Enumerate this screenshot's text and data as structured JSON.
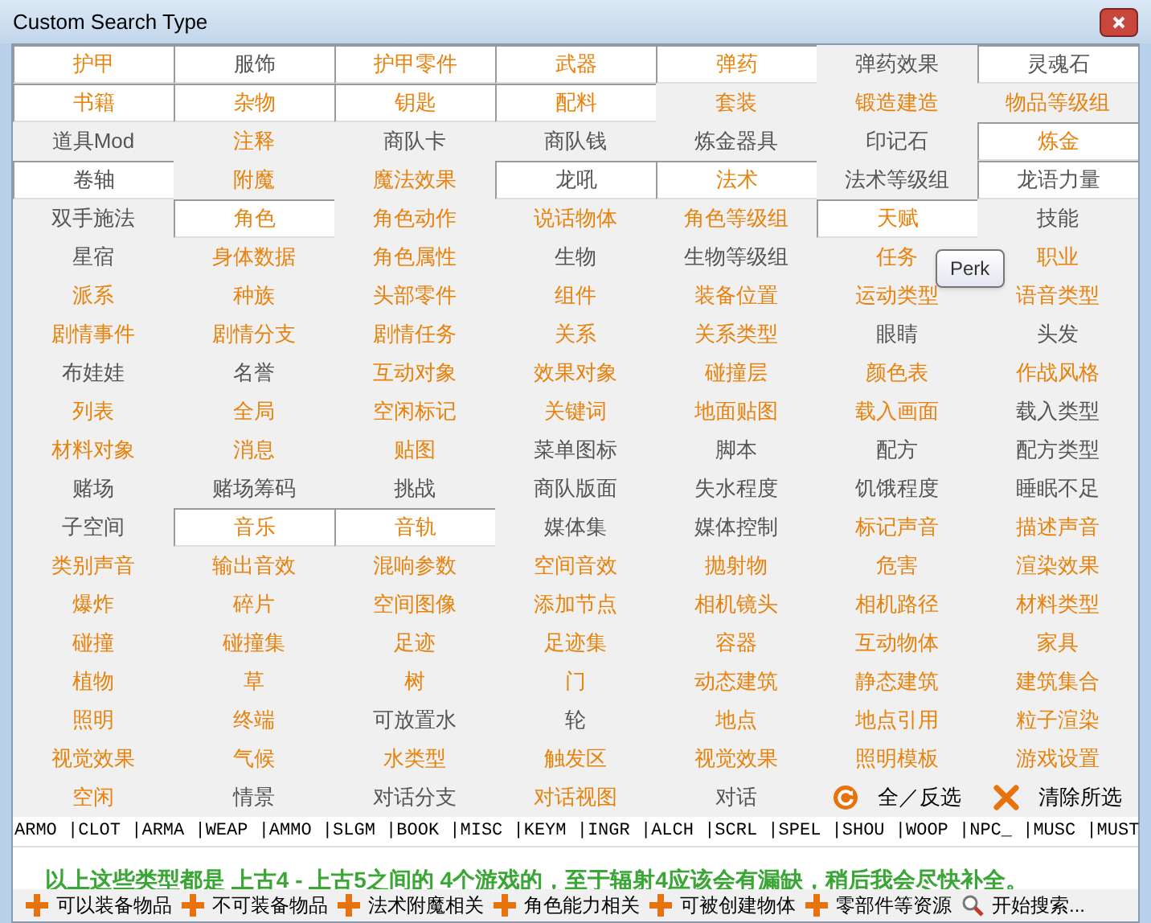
{
  "window": {
    "title": "Custom Search Type"
  },
  "types": [
    {
      "label": "护甲",
      "selected": true,
      "color": "#e8820c"
    },
    {
      "label": "服饰",
      "selected": true,
      "color": "#555555"
    },
    {
      "label": "护甲零件",
      "selected": true,
      "color": "#e8820c"
    },
    {
      "label": "武器",
      "selected": true,
      "color": "#e8820c"
    },
    {
      "label": "弹药",
      "selected": true,
      "color": "#e8820c"
    },
    {
      "label": "弹药效果",
      "selected": false,
      "color": "#555555"
    },
    {
      "label": "灵魂石",
      "selected": true,
      "color": "#555555"
    },
    {
      "label": "书籍",
      "selected": true,
      "color": "#e8820c"
    },
    {
      "label": "杂物",
      "selected": true,
      "color": "#e8820c"
    },
    {
      "label": "钥匙",
      "selected": true,
      "color": "#e8820c"
    },
    {
      "label": "配料",
      "selected": true,
      "color": "#e8820c"
    },
    {
      "label": "套装",
      "selected": false,
      "color": "#e8820c"
    },
    {
      "label": "锻造建造",
      "selected": false,
      "color": "#e8820c"
    },
    {
      "label": "物品等级组",
      "selected": false,
      "color": "#e8820c"
    },
    {
      "label": "道具Mod",
      "selected": false,
      "color": "#555555"
    },
    {
      "label": "注释",
      "selected": false,
      "color": "#e8820c"
    },
    {
      "label": "商队卡",
      "selected": false,
      "color": "#555555"
    },
    {
      "label": "商队钱",
      "selected": false,
      "color": "#555555"
    },
    {
      "label": "炼金器具",
      "selected": false,
      "color": "#555555"
    },
    {
      "label": "印记石",
      "selected": false,
      "color": "#555555"
    },
    {
      "label": "炼金",
      "selected": true,
      "color": "#e8820c"
    },
    {
      "label": "卷轴",
      "selected": true,
      "color": "#555555"
    },
    {
      "label": "附魔",
      "selected": false,
      "color": "#e8820c"
    },
    {
      "label": "魔法效果",
      "selected": false,
      "color": "#e8820c"
    },
    {
      "label": "龙吼",
      "selected": true,
      "color": "#555555"
    },
    {
      "label": "法术",
      "selected": true,
      "color": "#e8820c"
    },
    {
      "label": "法术等级组",
      "selected": false,
      "color": "#555555"
    },
    {
      "label": "龙语力量",
      "selected": true,
      "color": "#555555"
    },
    {
      "label": "双手施法",
      "selected": false,
      "color": "#555555"
    },
    {
      "label": "角色",
      "selected": true,
      "color": "#e8820c"
    },
    {
      "label": "角色动作",
      "selected": false,
      "color": "#e8820c"
    },
    {
      "label": "说话物体",
      "selected": false,
      "color": "#e8820c"
    },
    {
      "label": "角色等级组",
      "selected": false,
      "color": "#e8820c"
    },
    {
      "label": "天赋",
      "selected": true,
      "color": "#e8820c"
    },
    {
      "label": "技能",
      "selected": false,
      "color": "#555555"
    },
    {
      "label": "星宿",
      "selected": false,
      "color": "#555555"
    },
    {
      "label": "身体数据",
      "selected": false,
      "color": "#e8820c"
    },
    {
      "label": "角色属性",
      "selected": false,
      "color": "#e8820c"
    },
    {
      "label": "生物",
      "selected": false,
      "color": "#555555"
    },
    {
      "label": "生物等级组",
      "selected": false,
      "color": "#555555"
    },
    {
      "label": "任务",
      "selected": false,
      "color": "#e8820c"
    },
    {
      "label": "职业",
      "selected": false,
      "color": "#e8820c"
    },
    {
      "label": "派系",
      "selected": false,
      "color": "#e8820c"
    },
    {
      "label": "种族",
      "selected": false,
      "color": "#e8820c"
    },
    {
      "label": "头部零件",
      "selected": false,
      "color": "#e8820c"
    },
    {
      "label": "组件",
      "selected": false,
      "color": "#e8820c"
    },
    {
      "label": "装备位置",
      "selected": false,
      "color": "#e8820c"
    },
    {
      "label": "运动类型",
      "selected": false,
      "color": "#e8820c"
    },
    {
      "label": "语音类型",
      "selected": false,
      "color": "#e8820c"
    },
    {
      "label": "剧情事件",
      "selected": false,
      "color": "#e8820c"
    },
    {
      "label": "剧情分支",
      "selected": false,
      "color": "#e8820c"
    },
    {
      "label": "剧情任务",
      "selected": false,
      "color": "#e8820c"
    },
    {
      "label": "关系",
      "selected": false,
      "color": "#e8820c"
    },
    {
      "label": "关系类型",
      "selected": false,
      "color": "#e8820c"
    },
    {
      "label": "眼睛",
      "selected": false,
      "color": "#555555"
    },
    {
      "label": "头发",
      "selected": false,
      "color": "#555555"
    },
    {
      "label": "布娃娃",
      "selected": false,
      "color": "#555555"
    },
    {
      "label": "名誉",
      "selected": false,
      "color": "#555555"
    },
    {
      "label": "互动对象",
      "selected": false,
      "color": "#e8820c"
    },
    {
      "label": "效果对象",
      "selected": false,
      "color": "#e8820c"
    },
    {
      "label": "碰撞层",
      "selected": false,
      "color": "#e8820c"
    },
    {
      "label": "颜色表",
      "selected": false,
      "color": "#e8820c"
    },
    {
      "label": "作战风格",
      "selected": false,
      "color": "#e8820c"
    },
    {
      "label": "列表",
      "selected": false,
      "color": "#e8820c"
    },
    {
      "label": "全局",
      "selected": false,
      "color": "#e8820c"
    },
    {
      "label": "空闲标记",
      "selected": false,
      "color": "#e8820c"
    },
    {
      "label": "关键词",
      "selected": false,
      "color": "#e8820c"
    },
    {
      "label": "地面贴图",
      "selected": false,
      "color": "#e8820c"
    },
    {
      "label": "载入画面",
      "selected": false,
      "color": "#e8820c"
    },
    {
      "label": "载入类型",
      "selected": false,
      "color": "#555555"
    },
    {
      "label": "材料对象",
      "selected": false,
      "color": "#e8820c"
    },
    {
      "label": "消息",
      "selected": false,
      "color": "#e8820c"
    },
    {
      "label": "贴图",
      "selected": false,
      "color": "#e8820c"
    },
    {
      "label": "菜单图标",
      "selected": false,
      "color": "#555555"
    },
    {
      "label": "脚本",
      "selected": false,
      "color": "#555555"
    },
    {
      "label": "配方",
      "selected": false,
      "color": "#555555"
    },
    {
      "label": "配方类型",
      "selected": false,
      "color": "#555555"
    },
    {
      "label": "赌场",
      "selected": false,
      "color": "#555555"
    },
    {
      "label": "赌场筹码",
      "selected": false,
      "color": "#555555"
    },
    {
      "label": "挑战",
      "selected": false,
      "color": "#555555"
    },
    {
      "label": "商队版面",
      "selected": false,
      "color": "#555555"
    },
    {
      "label": "失水程度",
      "selected": false,
      "color": "#555555"
    },
    {
      "label": "饥饿程度",
      "selected": false,
      "color": "#555555"
    },
    {
      "label": "睡眠不足",
      "selected": false,
      "color": "#555555"
    },
    {
      "label": "子空间",
      "selected": false,
      "color": "#555555"
    },
    {
      "label": "音乐",
      "selected": true,
      "color": "#e8820c"
    },
    {
      "label": "音轨",
      "selected": true,
      "color": "#e8820c"
    },
    {
      "label": "媒体集",
      "selected": false,
      "color": "#555555"
    },
    {
      "label": "媒体控制",
      "selected": false,
      "color": "#555555"
    },
    {
      "label": "标记声音",
      "selected": false,
      "color": "#e8820c"
    },
    {
      "label": "描述声音",
      "selected": false,
      "color": "#e8820c"
    },
    {
      "label": "类别声音",
      "selected": false,
      "color": "#e8820c"
    },
    {
      "label": "输出音效",
      "selected": false,
      "color": "#e8820c"
    },
    {
      "label": "混响参数",
      "selected": false,
      "color": "#e8820c"
    },
    {
      "label": "空间音效",
      "selected": false,
      "color": "#e8820c"
    },
    {
      "label": "抛射物",
      "selected": false,
      "color": "#e8820c"
    },
    {
      "label": "危害",
      "selected": false,
      "color": "#e8820c"
    },
    {
      "label": "渲染效果",
      "selected": false,
      "color": "#e8820c"
    },
    {
      "label": "爆炸",
      "selected": false,
      "color": "#e8820c"
    },
    {
      "label": "碎片",
      "selected": false,
      "color": "#e8820c"
    },
    {
      "label": "空间图像",
      "selected": false,
      "color": "#e8820c"
    },
    {
      "label": "添加节点",
      "selected": false,
      "color": "#e8820c"
    },
    {
      "label": "相机镜头",
      "selected": false,
      "color": "#e8820c"
    },
    {
      "label": "相机路径",
      "selected": false,
      "color": "#e8820c"
    },
    {
      "label": "材料类型",
      "selected": false,
      "color": "#e8820c"
    },
    {
      "label": "碰撞",
      "selected": false,
      "color": "#e8820c"
    },
    {
      "label": "碰撞集",
      "selected": false,
      "color": "#e8820c"
    },
    {
      "label": "足迹",
      "selected": false,
      "color": "#e8820c"
    },
    {
      "label": "足迹集",
      "selected": false,
      "color": "#e8820c"
    },
    {
      "label": "容器",
      "selected": false,
      "color": "#e8820c"
    },
    {
      "label": "互动物体",
      "selected": false,
      "color": "#e8820c"
    },
    {
      "label": "家具",
      "selected": false,
      "color": "#e8820c"
    },
    {
      "label": "植物",
      "selected": false,
      "color": "#e8820c"
    },
    {
      "label": "草",
      "selected": false,
      "color": "#e8820c"
    },
    {
      "label": "树",
      "selected": false,
      "color": "#e8820c"
    },
    {
      "label": "门",
      "selected": false,
      "color": "#e8820c"
    },
    {
      "label": "动态建筑",
      "selected": false,
      "color": "#e8820c"
    },
    {
      "label": "静态建筑",
      "selected": false,
      "color": "#e8820c"
    },
    {
      "label": "建筑集合",
      "selected": false,
      "color": "#e8820c"
    },
    {
      "label": "照明",
      "selected": false,
      "color": "#e8820c"
    },
    {
      "label": "终端",
      "selected": false,
      "color": "#e8820c"
    },
    {
      "label": "可放置水",
      "selected": false,
      "color": "#555555"
    },
    {
      "label": "轮",
      "selected": false,
      "color": "#555555"
    },
    {
      "label": "地点",
      "selected": false,
      "color": "#e8820c"
    },
    {
      "label": "地点引用",
      "selected": false,
      "color": "#e8820c"
    },
    {
      "label": "粒子渲染",
      "selected": false,
      "color": "#e8820c"
    },
    {
      "label": "视觉效果",
      "selected": false,
      "color": "#e8820c"
    },
    {
      "label": "气候",
      "selected": false,
      "color": "#e8820c"
    },
    {
      "label": "水类型",
      "selected": false,
      "color": "#e8820c"
    },
    {
      "label": "触发区",
      "selected": false,
      "color": "#e8820c"
    },
    {
      "label": "视觉效果",
      "selected": false,
      "color": "#e8820c"
    },
    {
      "label": "照明模板",
      "selected": false,
      "color": "#e8820c"
    },
    {
      "label": "游戏设置",
      "selected": false,
      "color": "#e8820c"
    },
    {
      "label": "空闲",
      "selected": false,
      "color": "#e8820c"
    },
    {
      "label": "情景",
      "selected": false,
      "color": "#555555"
    },
    {
      "label": "对话分支",
      "selected": false,
      "color": "#555555"
    },
    {
      "label": "对话视图",
      "selected": false,
      "color": "#e8820c"
    },
    {
      "label": "对话",
      "selected": false,
      "color": "#555555"
    }
  ],
  "actions": [
    {
      "kind": "toggle",
      "label": "全／反选"
    },
    {
      "kind": "clear",
      "label": "清除所选"
    }
  ],
  "tooltip": {
    "text": "Perk"
  },
  "codes": "ARMO |CLOT |ARMA |WEAP |AMMO |SLGM |BOOK |MISC |KEYM |INGR |ALCH |SCRL |SPEL |SHOU |WOOP |NPC_ |MUSC |MUST",
  "message": "以上这些类型都是 上古4 - 上古5之间的 4个游戏的，至于辐射4应该会有漏缺，稍后我会尽快补全。",
  "toolbar": [
    {
      "kind": "add",
      "label": "可以装备物品"
    },
    {
      "kind": "add",
      "label": "不可装备物品"
    },
    {
      "kind": "add",
      "label": "法术附魔相关"
    },
    {
      "kind": "add",
      "label": "角色能力相关"
    },
    {
      "kind": "add",
      "label": "可被创建物体"
    },
    {
      "kind": "add",
      "label": "零部件等资源"
    },
    {
      "kind": "search",
      "label": "开始搜索..."
    }
  ]
}
